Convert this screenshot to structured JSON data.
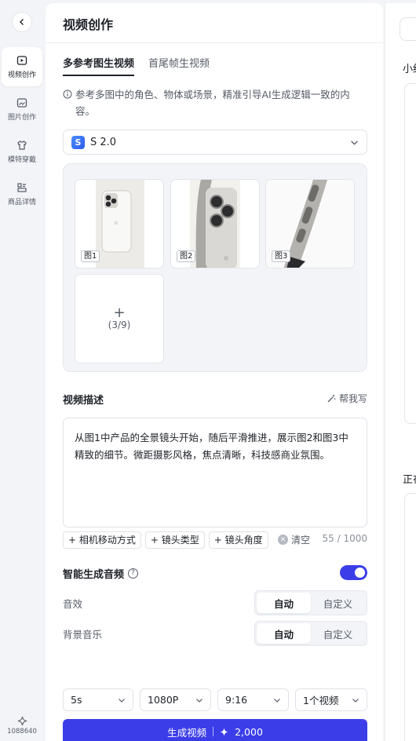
{
  "sidebar": {
    "items": [
      {
        "label": "视频创作",
        "icon": "video-create-icon",
        "active": true
      },
      {
        "label": "图片创作",
        "icon": "image-create-icon",
        "active": false
      },
      {
        "label": "模特穿戴",
        "icon": "tshirt-icon",
        "active": false
      },
      {
        "label": "商品详情",
        "icon": "product-detail-icon",
        "active": false
      }
    ],
    "credits": "1088640"
  },
  "panel": {
    "title": "视频创作",
    "tabs": [
      "多参考图生视频",
      "首尾帧生视频"
    ],
    "info_text": "参考多图中的角色、物体或场景，精准引导AI生成逻辑一致的内容。",
    "model": {
      "logo": "S",
      "name": "S 2.0"
    },
    "images": [
      {
        "tag": "图1"
      },
      {
        "tag": "图2"
      },
      {
        "tag": "图3"
      }
    ],
    "add": {
      "plus": "+",
      "count": "(3/9)"
    },
    "desc": {
      "title": "视频描述",
      "help_label": "帮我写",
      "text": "从图1中产品的全景镜头开始，随后平滑推进，展示图2和图3中精致的细节。微距摄影风格，焦点清晰，科技感商业氛围。",
      "chips": [
        "+ 相机移动方式",
        "+ 镜头类型",
        "+ 镜头角度"
      ],
      "clear_label": "清空",
      "counter": "55 / 1000"
    },
    "audio": {
      "title": "智能生成音频",
      "enabled": true,
      "rows": [
        {
          "label": "音效",
          "options": [
            "自动",
            "自定义"
          ],
          "selected": "自动"
        },
        {
          "label": "背景音乐",
          "options": [
            "自动",
            "自定义"
          ],
          "selected": "自动"
        }
      ]
    },
    "params": [
      {
        "value": "5s"
      },
      {
        "value": "1080P"
      },
      {
        "value": "9:16"
      },
      {
        "value": "1个视频"
      }
    ],
    "generate": {
      "label": "生成视频",
      "cost": "2,000"
    }
  },
  "right_panel": {
    "label_1": "小红",
    "label_2": "正在"
  },
  "colors": {
    "accent": "#3b3ee8",
    "bg": "#f3f4f8"
  }
}
